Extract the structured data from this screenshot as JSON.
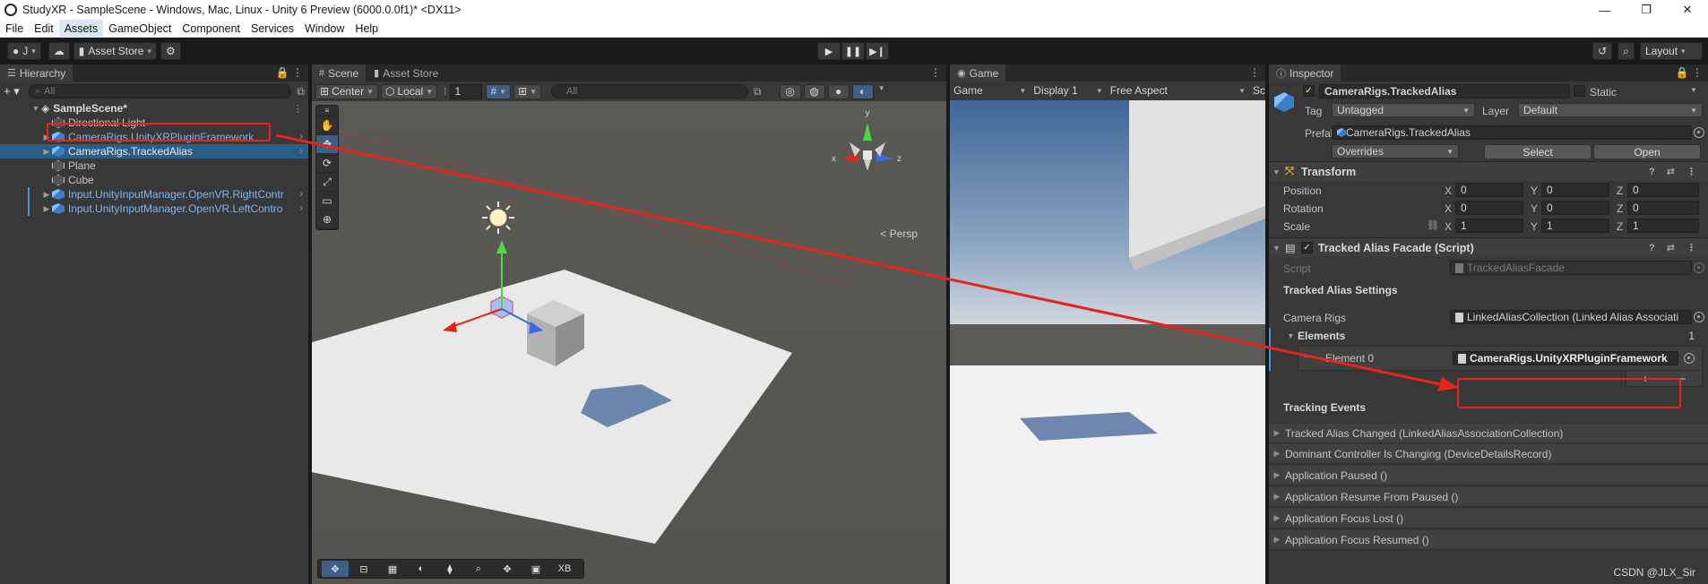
{
  "window": {
    "title": "StudyXR - SampleScene - Windows, Mac, Linux - Unity 6 Preview (6000.0.0f1)* <DX11>",
    "minimize": "—",
    "restore": "❐",
    "close": "✕"
  },
  "menu": [
    "File",
    "Edit",
    "Assets",
    "GameObject",
    "Component",
    "Services",
    "Window",
    "Help"
  ],
  "toolbar": {
    "account": "J",
    "asset_store": "Asset Store",
    "layout": "Layout"
  },
  "hierarchy": {
    "tab": "Hierarchy",
    "search_placeholder": "All",
    "scene": "SampleScene*",
    "items": [
      {
        "label": "Directional Light"
      },
      {
        "label": "CameraRigs.UnityXRPluginFramework"
      },
      {
        "label": "CameraRigs.TrackedAlias"
      },
      {
        "label": "Plane"
      },
      {
        "label": "Cube"
      },
      {
        "label": "Input.UnityInputManager.OpenVR.RightContr"
      },
      {
        "label": "Input.UnityInputManager.OpenVR.LeftContro"
      }
    ]
  },
  "scene": {
    "tabs": [
      "Scene",
      "Asset Store"
    ],
    "pivot": "Center",
    "space": "Local",
    "grid_size": "1",
    "search_placeholder": "All",
    "persp": "< Persp",
    "axis_x": "x",
    "axis_y": "y",
    "axis_z": "z",
    "bottom_label": "XB"
  },
  "game": {
    "tab": "Game",
    "mode": "Game",
    "display": "Display 1",
    "aspect": "Free Aspect",
    "scale": "Sc"
  },
  "inspector": {
    "tab": "Inspector",
    "object_name": "CameraRigs.TrackedAlias",
    "static_label": "Static",
    "tag_label": "Tag",
    "tag_value": "Untagged",
    "layer_label": "Layer",
    "layer_value": "Default",
    "prefab_label": "Prefab",
    "prefab_value": "CameraRigs.TrackedAlias",
    "overrides": "Overrides",
    "select": "Select",
    "open": "Open",
    "transform": {
      "title": "Transform",
      "position_label": "Position",
      "rotation_label": "Rotation",
      "scale_label": "Scale",
      "position": {
        "x": "0",
        "y": "0",
        "z": "0"
      },
      "rotation": {
        "x": "0",
        "y": "0",
        "z": "0"
      },
      "scale": {
        "x": "1",
        "y": "1",
        "z": "1"
      }
    },
    "facade": {
      "title": "Tracked Alias Facade (Script)",
      "script_label": "Script",
      "script_value": "TrackedAliasFacade",
      "settings_title": "Tracked Alias Settings",
      "camera_rigs_label": "Camera Rigs",
      "camera_rigs_value": "LinkedAliasCollection (Linked Alias Associati",
      "elements_label": "Elements",
      "elements_count": "1",
      "element0_label": "Element 0",
      "element0_value": "CameraRigs.UnityXRPluginFramework",
      "plus": "+",
      "minus": "−",
      "tracking_events_title": "Tracking Events",
      "events": [
        "Tracked Alias Changed (LinkedAliasAssociationCollection)",
        "Dominant Controller Is Changing (DeviceDetailsRecord)",
        "Application Paused ()",
        "Application Resume From Paused ()",
        "Application Focus Lost ()",
        "Application Focus Resumed ()"
      ]
    }
  },
  "watermark": "CSDN @JLX_Sir",
  "colors": {
    "selection": "#2c5d87",
    "prefab_text": "#7cb6f4",
    "annotation_red": "#e8231a"
  }
}
